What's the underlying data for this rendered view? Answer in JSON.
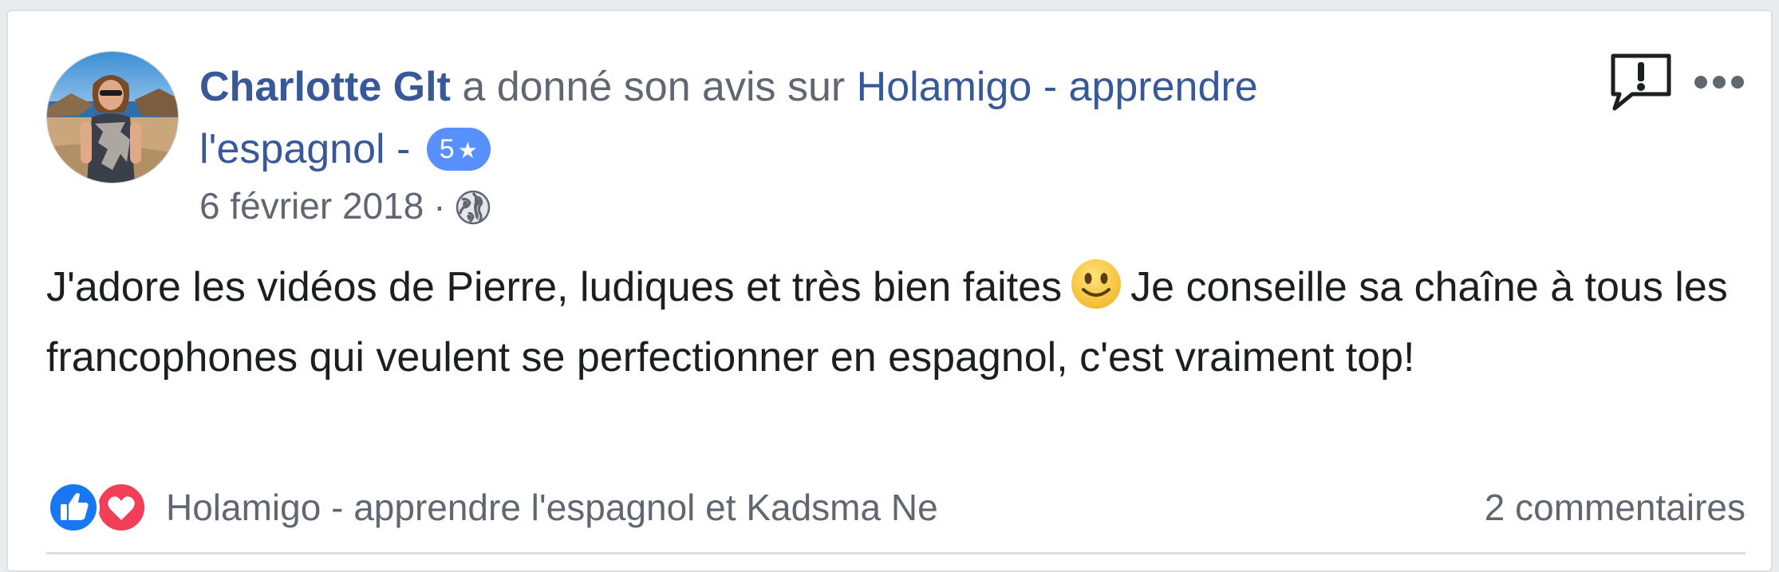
{
  "review": {
    "author": "Charlotte Glt",
    "action_text": " a donné son avis sur ",
    "page_name_line1": "Holamigo - apprendre",
    "page_name_line2": "l'espagnol",
    "dash": " -",
    "rating": "5",
    "star": "★",
    "date": "6 février 2018",
    "separator": "·",
    "privacy_icon": "globe-icon",
    "text_part1": "J'adore les vidéos de Pierre, ludiques et très bien faites",
    "text_part2": "Je conseille sa chaîne à tous les francophones qui veulent se perfectionner en espagnol, c'est vraiment top!",
    "emoji": "smiley-emoji"
  },
  "actions": {
    "report_icon": "report-icon",
    "more_icon": "more-dots-icon"
  },
  "footer": {
    "reaction_icons": [
      "like-icon",
      "love-icon"
    ],
    "reactors": "Holamigo - apprendre l'espagnol et Kadsma Ne",
    "comments": "2 commentaires"
  },
  "colors": {
    "link": "#385898",
    "secondary": "#616770",
    "badge": "#5890ff",
    "like": "#1877f2",
    "love": "#f33e58"
  }
}
